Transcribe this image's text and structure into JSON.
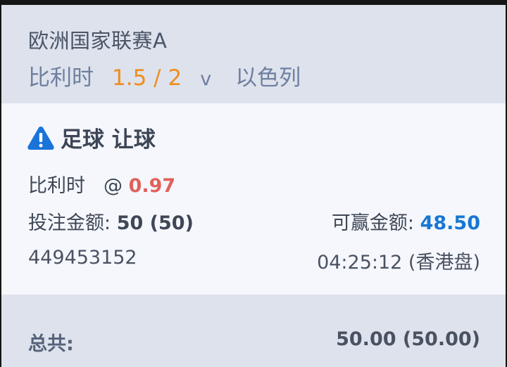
{
  "league": "欧洲国家联赛A",
  "match": {
    "home": "比利时",
    "handicap": "1.5 / 2",
    "vs": "v",
    "away": "以色列"
  },
  "bet": {
    "type": "足球 让球",
    "selection": "比利时",
    "at": "@",
    "odds": "0.97",
    "stake_label": "投注金额:",
    "stake_value": "50 (50)",
    "win_label": "可赢金额:",
    "win_value": "48.50",
    "ticket_id": "449453152",
    "time": "04:25:12 (香港盘)"
  },
  "total": {
    "label": "总共:",
    "value": "50.00 (50.00)"
  },
  "colors": {
    "handicap": "#ef8d1f",
    "odds": "#e0625a",
    "win_value": "#1677d2",
    "warning_icon": "#1a73d9"
  },
  "icons": {
    "warning": "warning-triangle-icon"
  }
}
